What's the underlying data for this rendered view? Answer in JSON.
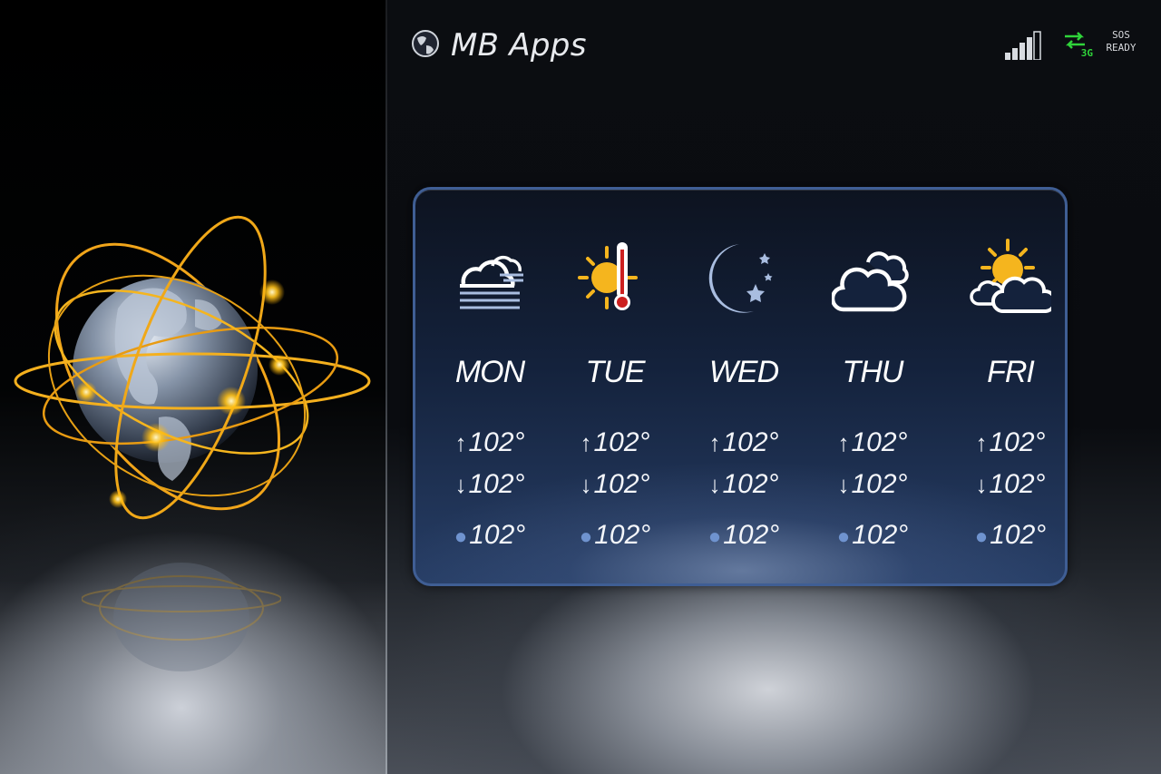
{
  "header": {
    "title": "MB Apps",
    "network": "3G",
    "sos_line1": "SOS",
    "sos_line2": "READY"
  },
  "forecast": [
    {
      "day": "MON",
      "icon": "fog-cloud-icon",
      "high": "102°",
      "low": "102°",
      "precip": "102°"
    },
    {
      "day": "TUE",
      "icon": "sun-thermometer-icon",
      "high": "102°",
      "low": "102°",
      "precip": "102°"
    },
    {
      "day": "WED",
      "icon": "moon-stars-icon",
      "high": "102°",
      "low": "102°",
      "precip": "102°"
    },
    {
      "day": "THU",
      "icon": "clouds-icon",
      "high": "102°",
      "low": "102°",
      "precip": "102°"
    },
    {
      "day": "FRI",
      "icon": "sun-cloud-icon",
      "high": "102°",
      "low": "102°",
      "precip": "102°"
    }
  ],
  "symbols": {
    "up": "↑",
    "down": "↓",
    "drop": "💧"
  },
  "colors": {
    "accent_gold": "#f5b51e",
    "card_border": "#3f5e94",
    "network_green": "#2fd43a",
    "precip_blue": "#6f93cf"
  }
}
